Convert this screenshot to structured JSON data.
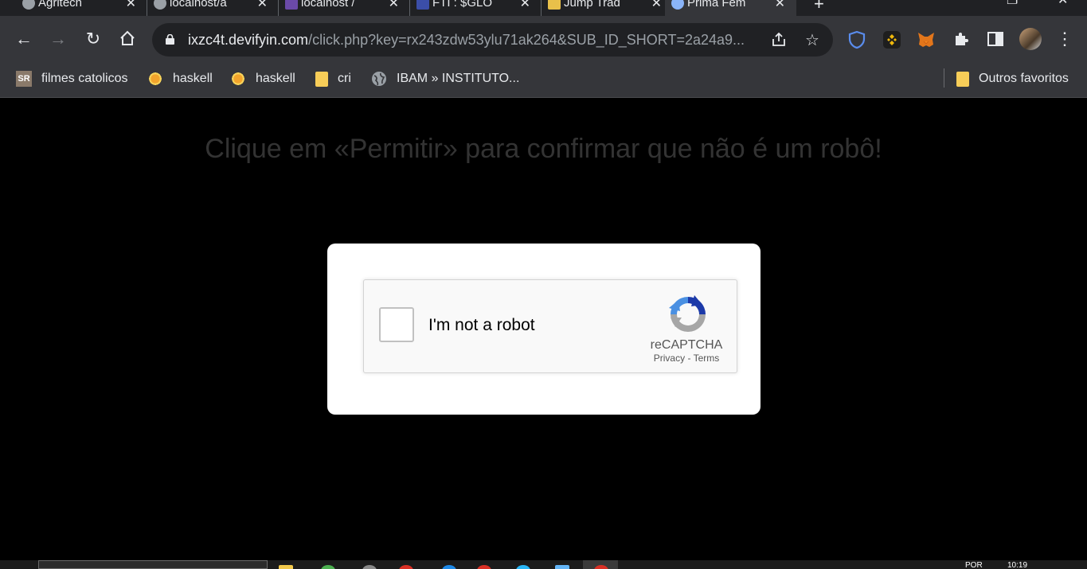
{
  "browser": {
    "tabs": [
      {
        "title": "Agritech",
        "active": false
      },
      {
        "title": "localhost/a",
        "active": false
      },
      {
        "title": "localhost /",
        "active": false
      },
      {
        "title": "FTI : $GLO",
        "active": false
      },
      {
        "title": "Jump Trad",
        "active": false
      },
      {
        "title": "Prima Fem",
        "active": true
      }
    ],
    "new_tab": "+",
    "url_host": "ixzc4t.devifyin.com",
    "url_path": "/click.php?key=rx243zdw53ylu71ak264&SUB_ID_SHORT=2a24a9...",
    "bookmarks": [
      {
        "label": "filmes catolicos",
        "icon": "sr-icon"
      },
      {
        "label": "haskell",
        "icon": "sun-icon"
      },
      {
        "label": "haskell",
        "icon": "sun-icon"
      },
      {
        "label": "cri",
        "icon": "folder-icon"
      },
      {
        "label": "IBAM » INSTITUTO...",
        "icon": "globe-icon"
      }
    ],
    "other_bookmarks": "Outros favoritos"
  },
  "page": {
    "headline": "Clique em «Permitir» para confirmar que não é um robô!",
    "recaptcha": {
      "label": "I'm not a robot",
      "brand": "reCAPTCHA",
      "privacy": "Privacy",
      "separator": " - ",
      "terms": "Terms"
    }
  },
  "taskbar": {
    "lang": "POR",
    "time": "10:19"
  },
  "colors": {
    "chrome_dark": "#202124",
    "chrome_toolbar": "#35363a",
    "page_bg": "#000000",
    "headline": "#333333",
    "recaptcha_blue": "#1c3aa9",
    "recaptcha_lightblue": "#4a90e2",
    "recaptcha_gray": "#a6a6a6"
  }
}
